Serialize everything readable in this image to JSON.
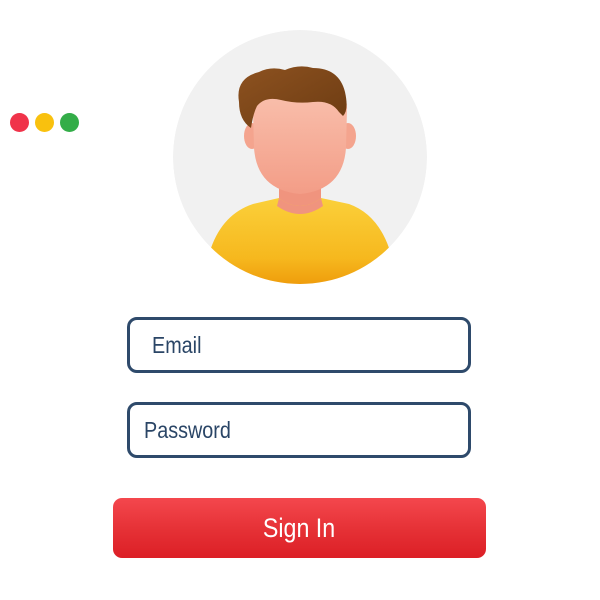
{
  "window_controls": {
    "buttons": [
      {
        "name": "close",
        "color": "#f0334a"
      },
      {
        "name": "minimize",
        "color": "#f9c10e"
      },
      {
        "name": "maximize",
        "color": "#33ad48"
      }
    ]
  },
  "avatar": {
    "icon": "user-avatar-icon",
    "background_color": "#f1f1f1",
    "hair_color": "#7b4518",
    "skin_color": "#f4a48e",
    "shirt_color": "#f6b81e"
  },
  "form": {
    "email_placeholder": "Email",
    "password_placeholder": "Password",
    "signin_label": "Sign In",
    "field_border_color": "#2e4a6b",
    "button_color": "#e53035"
  }
}
